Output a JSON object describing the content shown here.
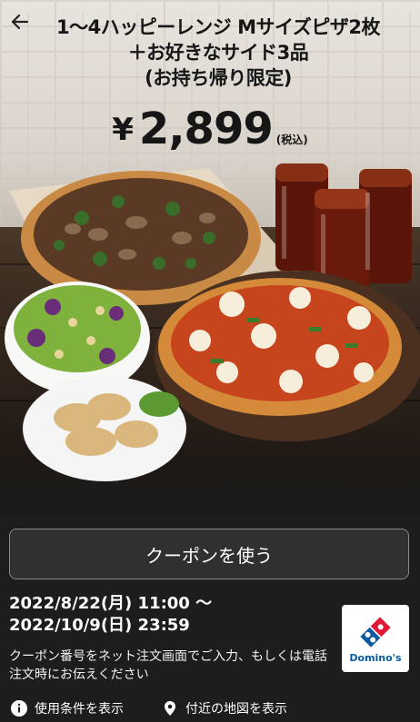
{
  "header": {
    "back_icon": "arrow-left-icon",
    "title_line1": "1〜4ハッピーレンジ Mサイズピザ2枚",
    "title_line2": "＋お好きなサイド3品",
    "title_line3": "(お持ち帰り限定)"
  },
  "price": {
    "currency": "¥",
    "amount": "2,899",
    "tax_note": "(税込)"
  },
  "coupon": {
    "button_label": "クーポンを使う",
    "date_start": "2022/8/22(月) 11:00 〜",
    "date_end": "2022/10/9(日) 23:59",
    "instructions": "クーポン番号をネット注文画面でご入力、もしくは電話注文時にお伝えください"
  },
  "brand": {
    "logo_text": "Domino's",
    "colors": {
      "blue": "#0a5aa0",
      "red": "#e31837"
    }
  },
  "footer": {
    "terms_label": "使用条件を表示",
    "terms_icon": "info-icon",
    "map_label": "付近の地図を表示",
    "map_icon": "map-pin-icon"
  }
}
